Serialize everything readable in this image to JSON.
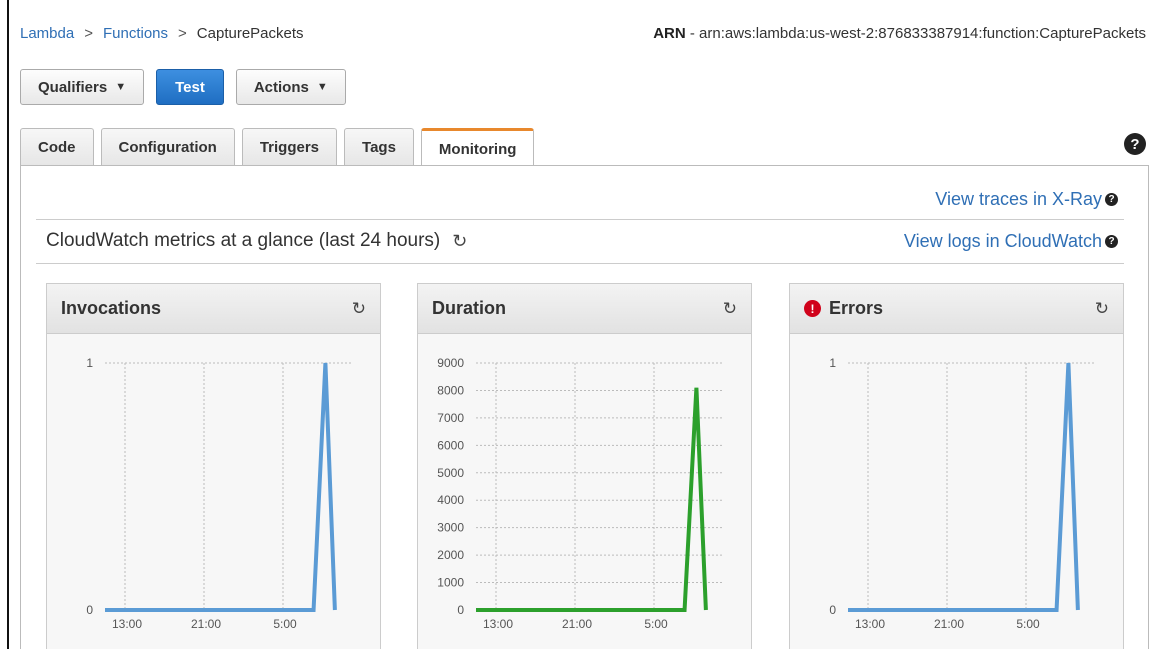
{
  "breadcrumb": {
    "items": [
      "Lambda",
      "Functions",
      "CapturePackets"
    ],
    "separator": ">"
  },
  "arn": {
    "label": "ARN",
    "value": "- arn:aws:lambda:us-west-2:876833387914:function:CapturePackets"
  },
  "toolbar": {
    "qualifiers": "Qualifiers",
    "test": "Test",
    "actions": "Actions",
    "caret": "▼"
  },
  "tabs": [
    "Code",
    "Configuration",
    "Triggers",
    "Tags",
    "Monitoring"
  ],
  "active_tab": "Monitoring",
  "help_icon": "?",
  "links": {
    "xray": "View traces in X-Ray",
    "cloudwatch": "View logs in CloudWatch",
    "help": "?"
  },
  "glance": {
    "text": "CloudWatch metrics at a glance (last 24 hours)",
    "refresh_icon": "refresh-icon"
  },
  "colors": {
    "link": "#2f6fb5",
    "primary": "#1f6ec2",
    "active_tab_accent": "#e8882d",
    "invocations_line": "#5b9bd5",
    "duration_line": "#2ca02c",
    "errors_line": "#5b9bd5",
    "error_icon": "#d0021b"
  },
  "chart_data": [
    {
      "type": "line",
      "title": "Invocations",
      "x": [
        "13:00",
        "21:00",
        "5:00"
      ],
      "xticks": [
        "13:00",
        "21:00",
        "5:00"
      ],
      "yticks": [
        "0",
        "1"
      ],
      "ylim": [
        0,
        1
      ],
      "series": [
        {
          "values": [
            0,
            0,
            0,
            0,
            0,
            1,
            0
          ]
        }
      ],
      "color": "#5b9bd5",
      "grid": true
    },
    {
      "type": "line",
      "title": "Duration",
      "xticks": [
        "13:00",
        "21:00",
        "5:00"
      ],
      "yticks": [
        "0",
        "1000",
        "2000",
        "3000",
        "4000",
        "5000",
        "6000",
        "7000",
        "8000",
        "9000"
      ],
      "ylim": [
        0,
        9000
      ],
      "series": [
        {
          "values": [
            0,
            0,
            0,
            0,
            0,
            8100,
            0
          ]
        }
      ],
      "color": "#2ca02c",
      "grid": true
    },
    {
      "type": "line",
      "title": "Errors",
      "xticks": [
        "13:00",
        "21:00",
        "5:00"
      ],
      "yticks": [
        "0",
        "1"
      ],
      "ylim": [
        0,
        1
      ],
      "series": [
        {
          "values": [
            0,
            0,
            0,
            0,
            0,
            1,
            0
          ]
        }
      ],
      "color": "#5b9bd5",
      "grid": true,
      "alert_icon": "!"
    }
  ]
}
